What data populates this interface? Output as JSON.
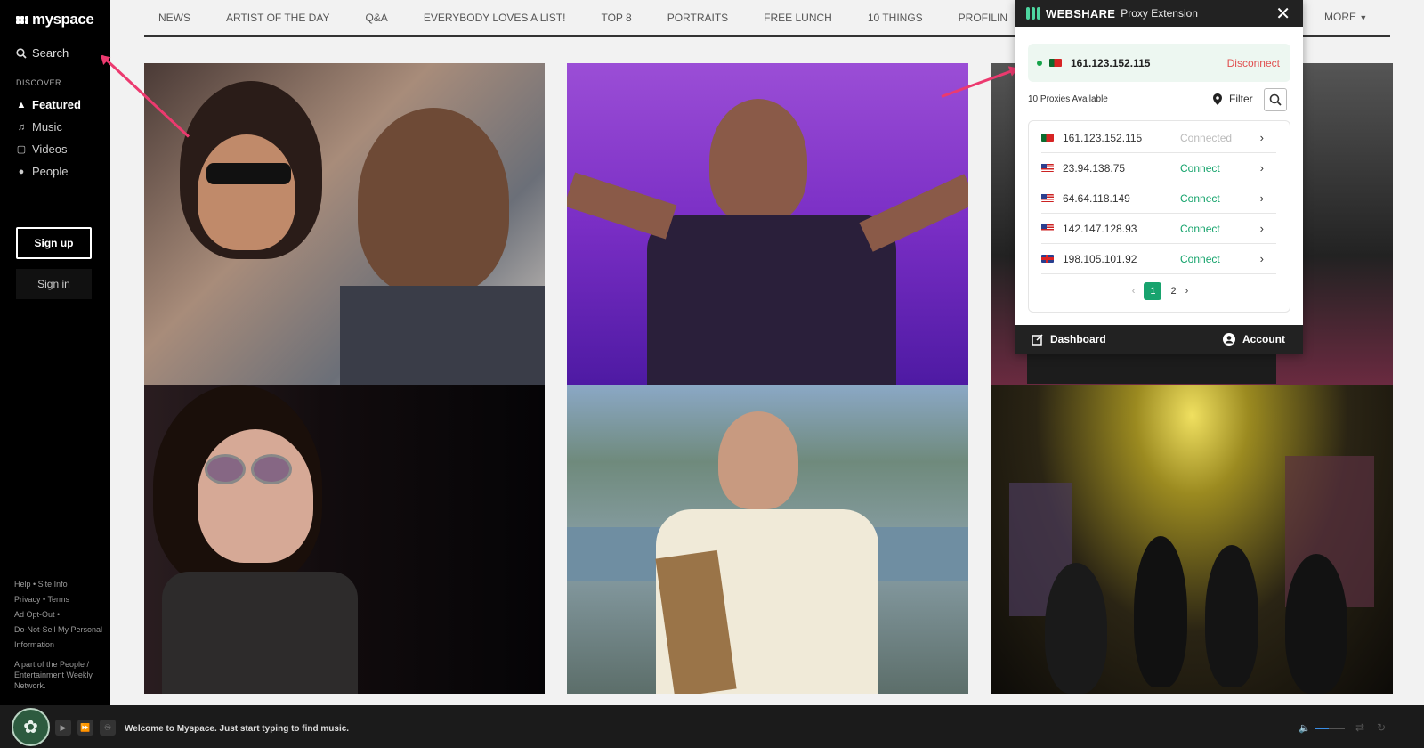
{
  "sidebar": {
    "logo": "myspace",
    "search_label": "Search",
    "discover_label": "DISCOVER",
    "items": [
      {
        "label": "Featured",
        "icon": "flame-icon"
      },
      {
        "label": "Music",
        "icon": "music-note-icon"
      },
      {
        "label": "Videos",
        "icon": "video-icon"
      },
      {
        "label": "People",
        "icon": "people-icon"
      }
    ],
    "signup_label": "Sign up",
    "signin_label": "Sign in",
    "footer_links": [
      "Help",
      "Site Info",
      "Privacy",
      "Terms",
      "Ad Opt-Out",
      "Do-Not-Sell My Personal Information"
    ],
    "footer_note": "A part of the People / Entertainment Weekly Network."
  },
  "topnav": {
    "items": [
      "NEWS",
      "ARTIST OF THE DAY",
      "Q&A",
      "EVERYBODY LOVES A LIST!",
      "TOP 8",
      "PORTRAITS",
      "FREE LUNCH",
      "10 THINGS",
      "PROFILIN"
    ],
    "more_label": "MORE"
  },
  "tiles": [
    {
      "name": "photo-couple"
    },
    {
      "name": "photo-drake-purple"
    },
    {
      "name": "photo-performer-dark"
    },
    {
      "name": "photo-ozzy"
    },
    {
      "name": "photo-man-landscape"
    },
    {
      "name": "photo-concert-stage"
    }
  ],
  "player": {
    "welcome": "Welcome to Myspace. Just start typing to find music."
  },
  "extension": {
    "brand": "WEBSHARE",
    "subtitle": "Proxy Extension",
    "current_ip": "161.123.152.115",
    "disconnect_label": "Disconnect",
    "available": "10 Proxies Available",
    "filter_label": "Filter",
    "proxies": [
      {
        "ip": "161.123.152.115",
        "flag": "pt",
        "action": "Connected",
        "connected": true
      },
      {
        "ip": "23.94.138.75",
        "flag": "us",
        "action": "Connect",
        "connected": false
      },
      {
        "ip": "64.64.118.149",
        "flag": "us",
        "action": "Connect",
        "connected": false
      },
      {
        "ip": "142.147.128.93",
        "flag": "us",
        "action": "Connect",
        "connected": false
      },
      {
        "ip": "198.105.101.92",
        "flag": "gb",
        "action": "Connect",
        "connected": false
      }
    ],
    "pages": [
      "1",
      "2"
    ],
    "dashboard_label": "Dashboard",
    "account_label": "Account"
  },
  "colors": {
    "accent": "#18a36e",
    "disconnect": "#e05050",
    "arrow": "#ec3a6f"
  }
}
